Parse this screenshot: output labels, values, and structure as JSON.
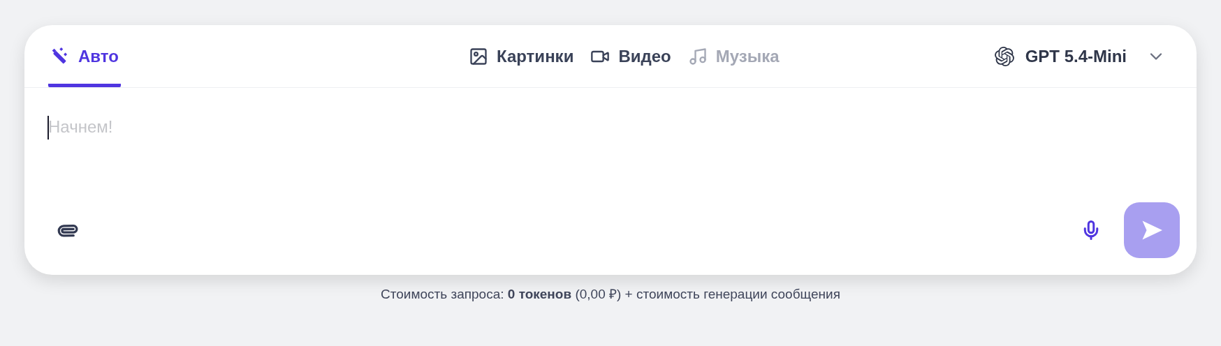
{
  "primary_tab": {
    "label": "Авто",
    "selected": true,
    "kind": "auto"
  },
  "media_tabs": [
    {
      "label": "Картинки",
      "kind": "images",
      "disabled": false
    },
    {
      "label": "Видео",
      "kind": "video",
      "disabled": false
    },
    {
      "label": "Музыка",
      "kind": "music",
      "disabled": true
    }
  ],
  "model_selector": {
    "label": "GPT 5.4-Mini"
  },
  "prompt": {
    "placeholder": "Начнем!"
  },
  "send_button": {
    "disabled": true
  },
  "footer": "Стоимость запроса: **0 токенов** (0,00 ₽) + стоимость генерации сообщения"
}
